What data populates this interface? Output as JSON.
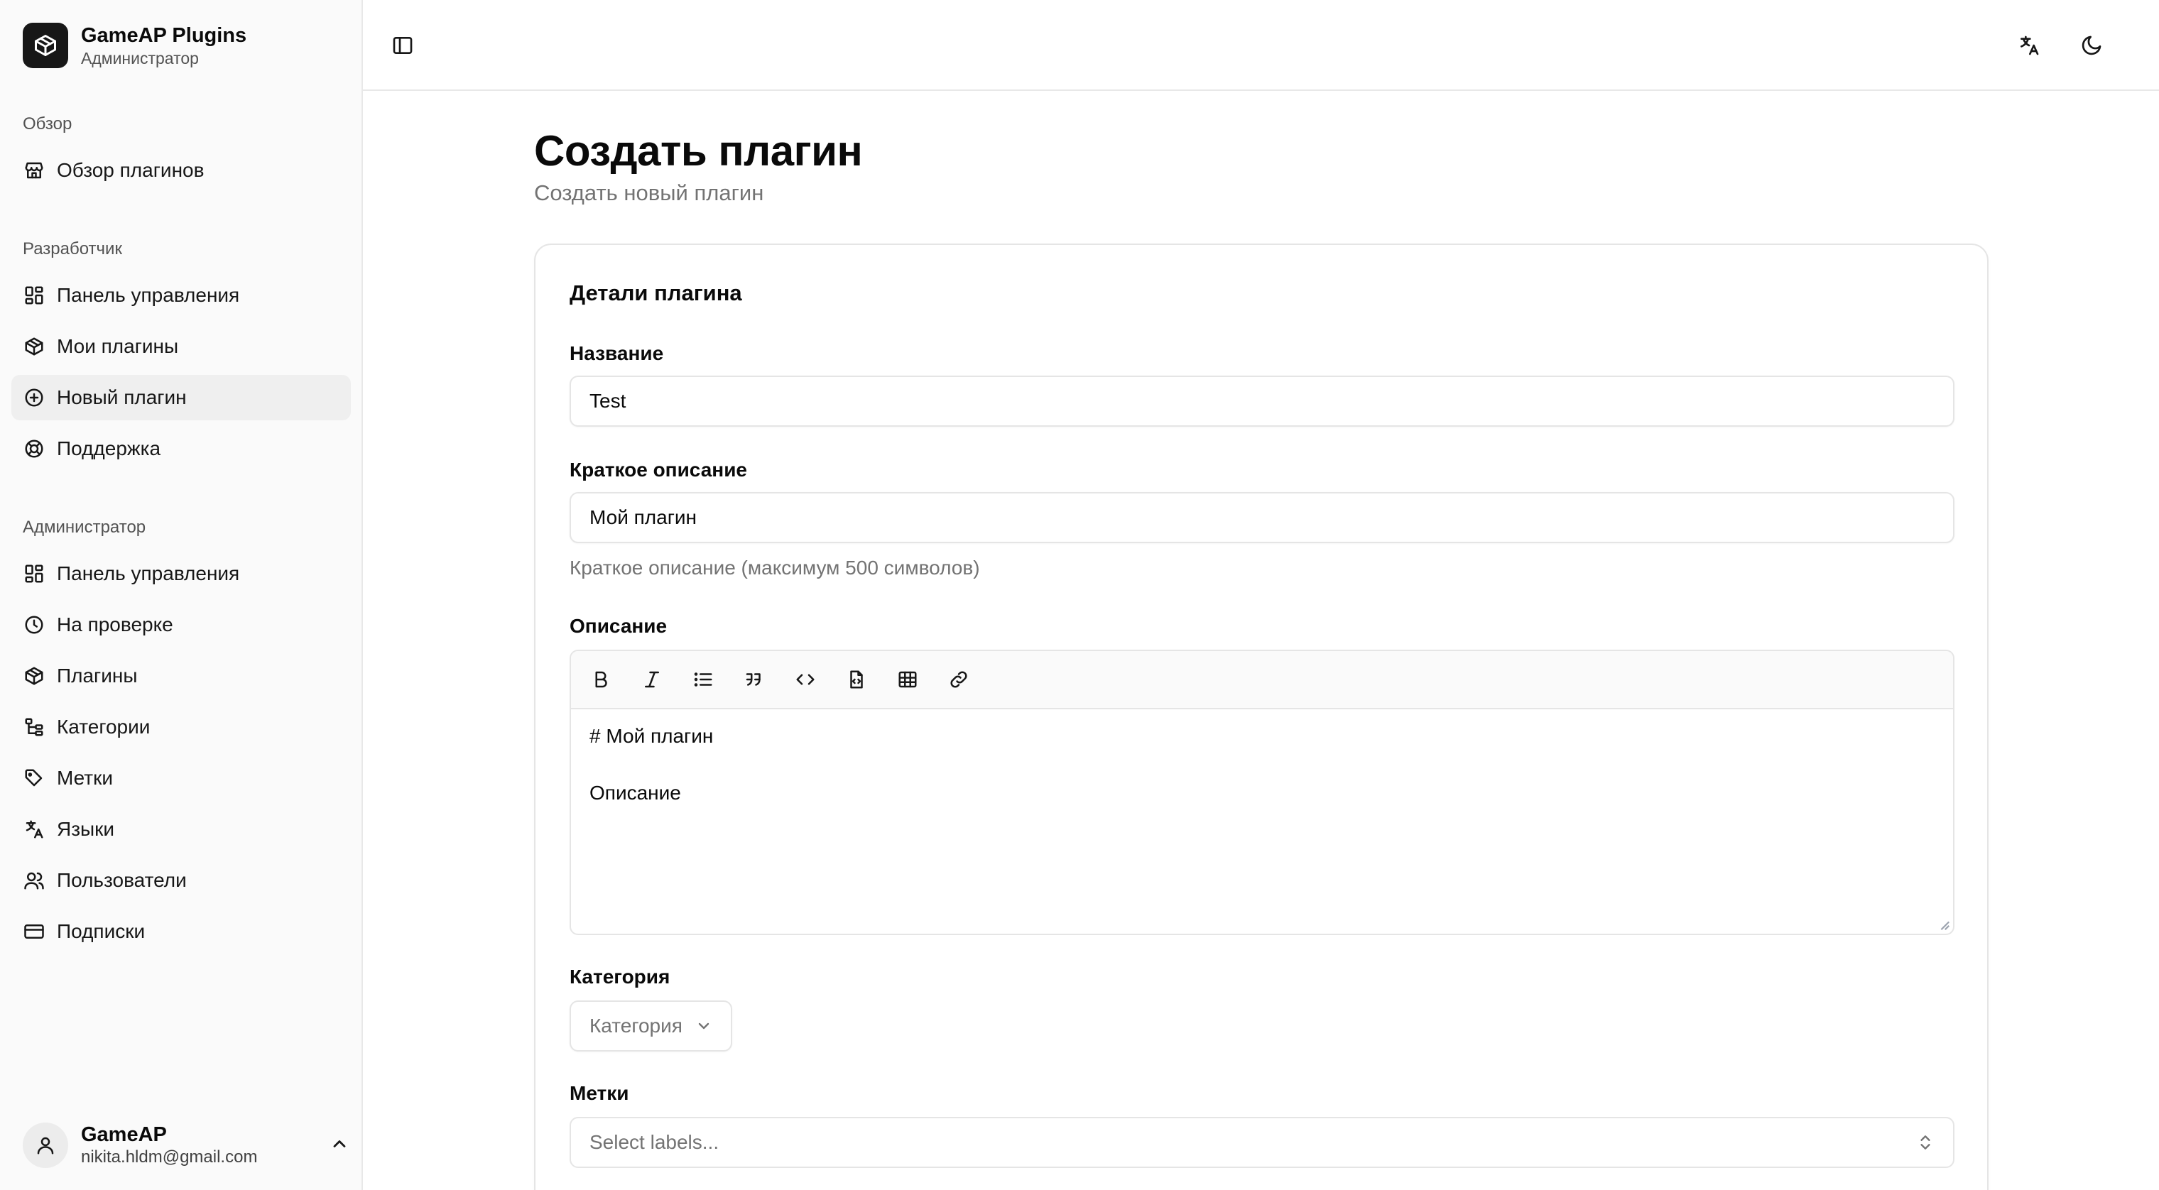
{
  "brand": {
    "title": "GameAP Plugins",
    "subtitle": "Администратор"
  },
  "sidebar": {
    "groups": [
      {
        "label": "Обзор",
        "items": [
          {
            "label": "Обзор плагинов",
            "icon": "store-icon"
          }
        ]
      },
      {
        "label": "Разработчик",
        "items": [
          {
            "label": "Панель управления",
            "icon": "dashboard-icon"
          },
          {
            "label": "Мои плагины",
            "icon": "package-icon"
          },
          {
            "label": "Новый плагин",
            "icon": "plus-circle-icon",
            "active": true
          },
          {
            "label": "Поддержка",
            "icon": "lifebuoy-icon"
          }
        ]
      },
      {
        "label": "Администратор",
        "items": [
          {
            "label": "Панель управления",
            "icon": "dashboard-icon"
          },
          {
            "label": "На проверке",
            "icon": "clock-icon"
          },
          {
            "label": "Плагины",
            "icon": "package-icon"
          },
          {
            "label": "Категории",
            "icon": "tree-icon"
          },
          {
            "label": "Метки",
            "icon": "tag-icon"
          },
          {
            "label": "Языки",
            "icon": "languages-icon"
          },
          {
            "label": "Пользователи",
            "icon": "users-icon"
          },
          {
            "label": "Подписки",
            "icon": "credit-card-icon"
          }
        ]
      }
    ]
  },
  "user": {
    "name": "GameAP",
    "email": "nikita.hldm@gmail.com"
  },
  "page": {
    "title": "Создать плагин",
    "subtitle": "Создать новый плагин"
  },
  "form": {
    "card_title": "Детали плагина",
    "name": {
      "label": "Название",
      "value": "Test"
    },
    "short_description": {
      "label": "Краткое описание",
      "value": "Мой плагин",
      "hint": "Краткое описание (максимум 500 символов)"
    },
    "description": {
      "label": "Описание",
      "lines": [
        "# Мой плагин",
        "",
        "Описание"
      ]
    },
    "category": {
      "label": "Категория",
      "placeholder": "Категория"
    },
    "labels": {
      "label": "Метки",
      "placeholder": "Select labels..."
    }
  }
}
